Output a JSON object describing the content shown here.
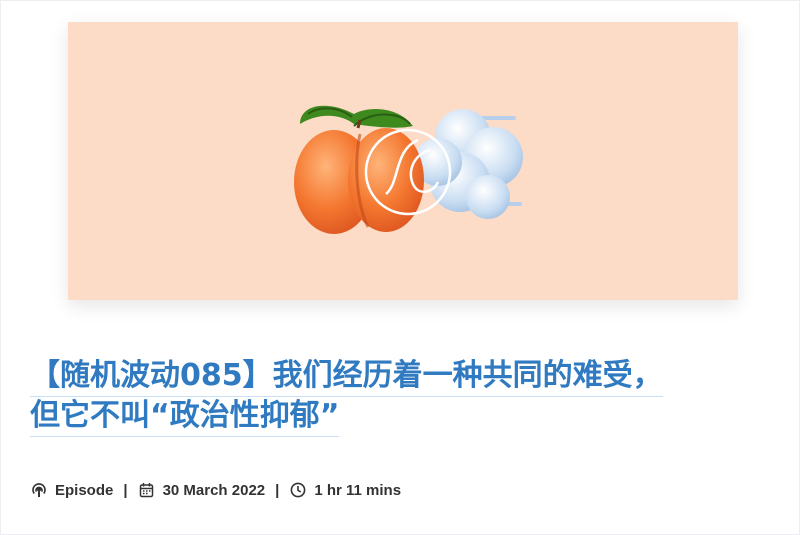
{
  "episode": {
    "title_line1": "【随机波动085】我们经历着一种共同的难受，",
    "title_line2": "但它不叫“政治性抑郁”",
    "type_label": "Episode",
    "date": "30 March 2022",
    "duration": "1 hr 11 mins",
    "separator": "|"
  },
  "icons": {
    "type": "podcast-icon",
    "date": "calendar-icon",
    "duration": "clock-icon"
  },
  "colors": {
    "title": "#2f7ac0",
    "hero_background": "#fcdcc7"
  }
}
